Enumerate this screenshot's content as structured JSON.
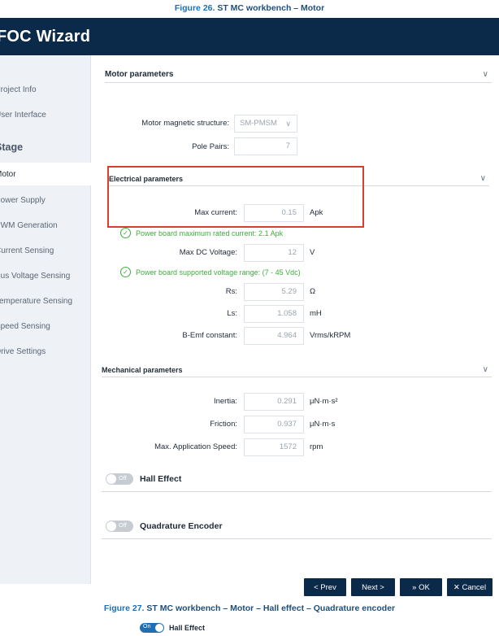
{
  "captions": {
    "fig26_number": "Figure 26.",
    "fig26_text": "ST MC workbench – Motor",
    "fig27_number": "Figure 27.",
    "fig27_text": "ST MC workbench – Motor – Hall effect – Quadrature encoder"
  },
  "window": {
    "title": "FOC Wizard"
  },
  "sidebar": {
    "items_top": [
      "Project Info",
      "User Interface"
    ],
    "heading": "Stage",
    "items": [
      "Motor",
      "Power Supply",
      "PWM Generation",
      "Current Sensing",
      "Bus Voltage Sensing",
      "Temperature Sensing",
      "Speed Sensing",
      "Drive Settings"
    ],
    "active": "Motor"
  },
  "motor_parameters": {
    "title": "Motor parameters",
    "magnetic_structure_label": "Motor magnetic structure:",
    "magnetic_structure_value": "SM-PMSM",
    "pole_pairs_label": "Pole Pairs:",
    "pole_pairs_value": "7"
  },
  "electrical_parameters": {
    "title": "Electrical parameters",
    "max_current_label": "Max current:",
    "max_current_value": "0.15",
    "max_current_unit": "Apk",
    "max_current_note": "Power board maximum rated current: 2.1 Apk",
    "max_dc_voltage_label": "Max DC Voltage:",
    "max_dc_voltage_value": "12",
    "max_dc_voltage_unit": "V",
    "voltage_note": "Power board supported voltage range: (7 - 45 Vdc)",
    "rs_label": "Rs:",
    "rs_value": "5.29",
    "rs_unit": "Ω",
    "ls_label": "Ls:",
    "ls_value": "1.058",
    "ls_unit": "mH",
    "bemf_label": "B-Emf constant:",
    "bemf_value": "4.964",
    "bemf_unit": "Vrms/kRPM"
  },
  "mechanical_parameters": {
    "title": "Mechanical parameters",
    "inertia_label": "Inertia:",
    "inertia_value": "0.291",
    "inertia_unit": "μN·m·s²",
    "friction_label": "Friction:",
    "friction_value": "0.937",
    "friction_unit": "μN·m·s",
    "max_speed_label": "Max. Application Speed:",
    "max_speed_value": "1572",
    "max_speed_unit": "rpm"
  },
  "sensors": {
    "hall_toggle_state": "Off",
    "hall_label": "Hall Effect",
    "encoder_toggle_state": "Off",
    "encoder_label": "Quadrature Encoder"
  },
  "footer": {
    "prev": "< Prev",
    "next": "Next >",
    "ok": "» OK",
    "cancel": "✕ Cancel"
  },
  "fig27": {
    "toggle_state": "On",
    "label": "Hall Effect"
  },
  "colors": {
    "titlebar": "#0b2a4a",
    "accent_green": "#3fae3f",
    "highlight_red": "#d9402b"
  }
}
